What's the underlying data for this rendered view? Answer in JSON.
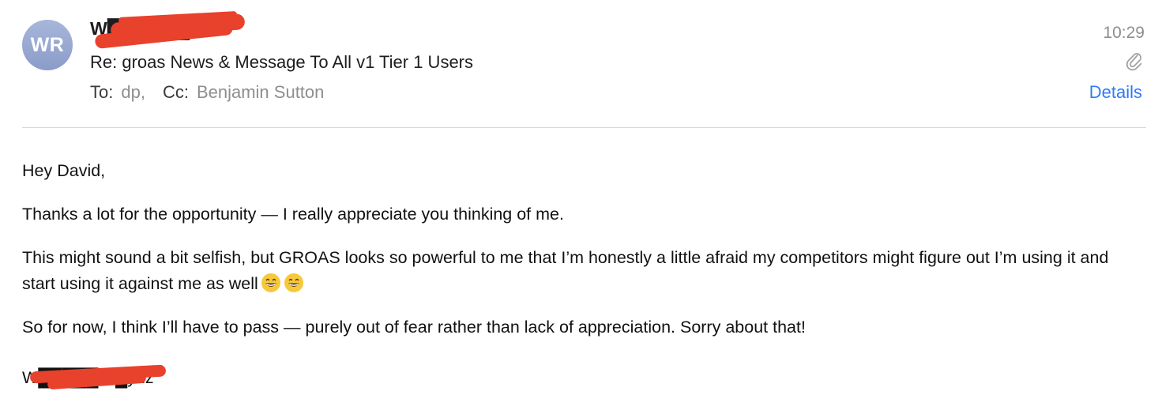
{
  "header": {
    "avatar_initials": "WR",
    "sender_name": "W███ R██dz",
    "subject": "Re: groas News & Message To All v1 Tier 1 Users",
    "to_label": "To:",
    "to_value": "dp,",
    "cc_label": "Cc:",
    "cc_value": "Benjamin Sutton",
    "time": "10:29",
    "attachment_icon": "paperclip-icon",
    "details_label": "Details"
  },
  "message": {
    "greeting": "Hey David,",
    "paragraph_1": "Thanks a lot for the opportunity — I really appreciate you thinking of me.",
    "paragraph_2": "This might sound a bit selfish, but GROAS looks so powerful to me that I’m honestly a little afraid my competitors might figure out I’m using it and start using it against me as well",
    "paragraph_3": "So for now, I think I’ll have to pass — purely out of fear rather than lack of appreciation. Sorry about that!",
    "signature": "W█████ R█ydz"
  },
  "colors": {
    "accent": "#2f7bf5",
    "redaction": "#e8412c",
    "avatar": "#9aaad3",
    "muted_text": "#8e8e93"
  }
}
